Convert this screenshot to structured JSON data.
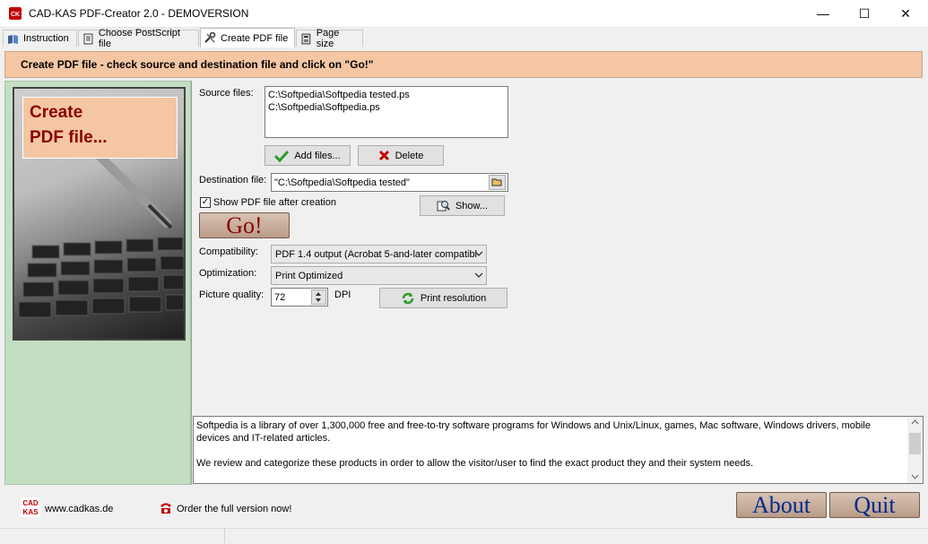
{
  "window": {
    "title": "CAD-KAS PDF-Creator 2.0 - DEMOVERSION",
    "minimize": "—",
    "maximize": "☐",
    "close": "✕"
  },
  "tabs": [
    {
      "label": "Instruction",
      "icon": "book-icon"
    },
    {
      "label": "Choose PostScript file",
      "icon": "document-icon"
    },
    {
      "label": "Create PDF file",
      "icon": "tools-icon",
      "active": true
    },
    {
      "label": "Page size",
      "icon": "page-icon"
    }
  ],
  "banner": "Create PDF file - check source and destination file and click on \"Go!\"",
  "sidepanel": {
    "label_line1": "Create",
    "label_line2": "PDF file..."
  },
  "form": {
    "source_label": "Source files:",
    "source_files": [
      "C:\\Softpedia\\Softpedia tested.ps",
      "C:\\Softpedia\\Softpedia.ps"
    ],
    "add_files": "Add files...",
    "delete": "Delete",
    "destination_label": "Destination file:",
    "destination_value": "\"C:\\Softpedia\\Softpedia tested\"",
    "show_pdf_label": "Show PDF file after creation",
    "show_pdf_checked": true,
    "show_button": "Show...",
    "go": "Go!",
    "compatibility_label": "Compatibility:",
    "compatibility_value": "PDF 1.4 output (Acrobat 5-and-later compatibl",
    "optimization_label": "Optimization:",
    "optimization_value": "Print Optimized",
    "quality_label": "Picture quality:",
    "quality_value": "72",
    "dpi_label": "DPI",
    "print_resolution": "Print resolution"
  },
  "info_text": {
    "para1": "Softpedia is a library of over 1,300,000 free and free-to-try software programs for Windows and Unix/Linux, games, Mac software, Windows drivers, mobile devices and IT-related articles.",
    "para2": "We review and categorize these products in order to allow the visitor/user to find the exact product they and their system needs."
  },
  "footer": {
    "website": "www.cadkas.de",
    "order": "Order the full version now!",
    "about": "About",
    "quit": "Quit"
  },
  "colors": {
    "banner": "#f4c6a4",
    "side_panel": "#c2dfc2",
    "go_text": "#8b0000",
    "about_text": "#002a8c"
  }
}
